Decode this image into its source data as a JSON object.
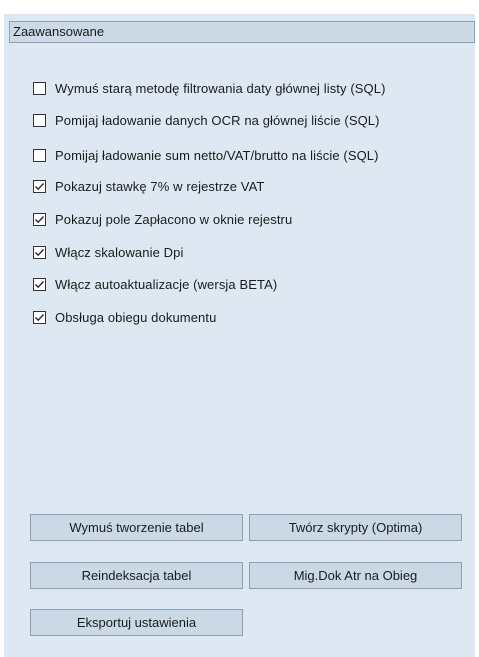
{
  "section": {
    "title": "Zaawansowane"
  },
  "options": [
    {
      "label": "Wymuś starą metodę filtrowania daty głównej listy (SQL)",
      "checked": false
    },
    {
      "label": "Pomijaj ładowanie danych OCR na głównej liście (SQL)",
      "checked": false
    },
    {
      "label": "Pomijaj ładowanie sum netto/VAT/brutto na liście (SQL)",
      "checked": false
    },
    {
      "label": "Pokazuj stawkę 7% w rejestrze VAT",
      "checked": true
    },
    {
      "label": "Pokazuj pole Zapłacono w oknie rejestru",
      "checked": true
    },
    {
      "label": "Włącz skalowanie Dpi",
      "checked": true
    },
    {
      "label": "Włącz autoaktualizacje (wersja BETA)",
      "checked": true
    },
    {
      "label": "Obsługa obiegu dokumentu",
      "checked": true
    }
  ],
  "buttons": {
    "force_tables": "Wymuś tworzenie tabel",
    "create_scripts": "Twórz skrypty (Optima)",
    "reindex": "Reindeksacja tabel",
    "migrate": "Mig.Dok Atr na Obieg",
    "export": "Eksportuj ustawienia"
  },
  "colors": {
    "panel_bg": "#dde8f3",
    "header_bg": "#ccd9e7",
    "button_bg": "#cbd9e7",
    "border": "#8e9fb3"
  }
}
